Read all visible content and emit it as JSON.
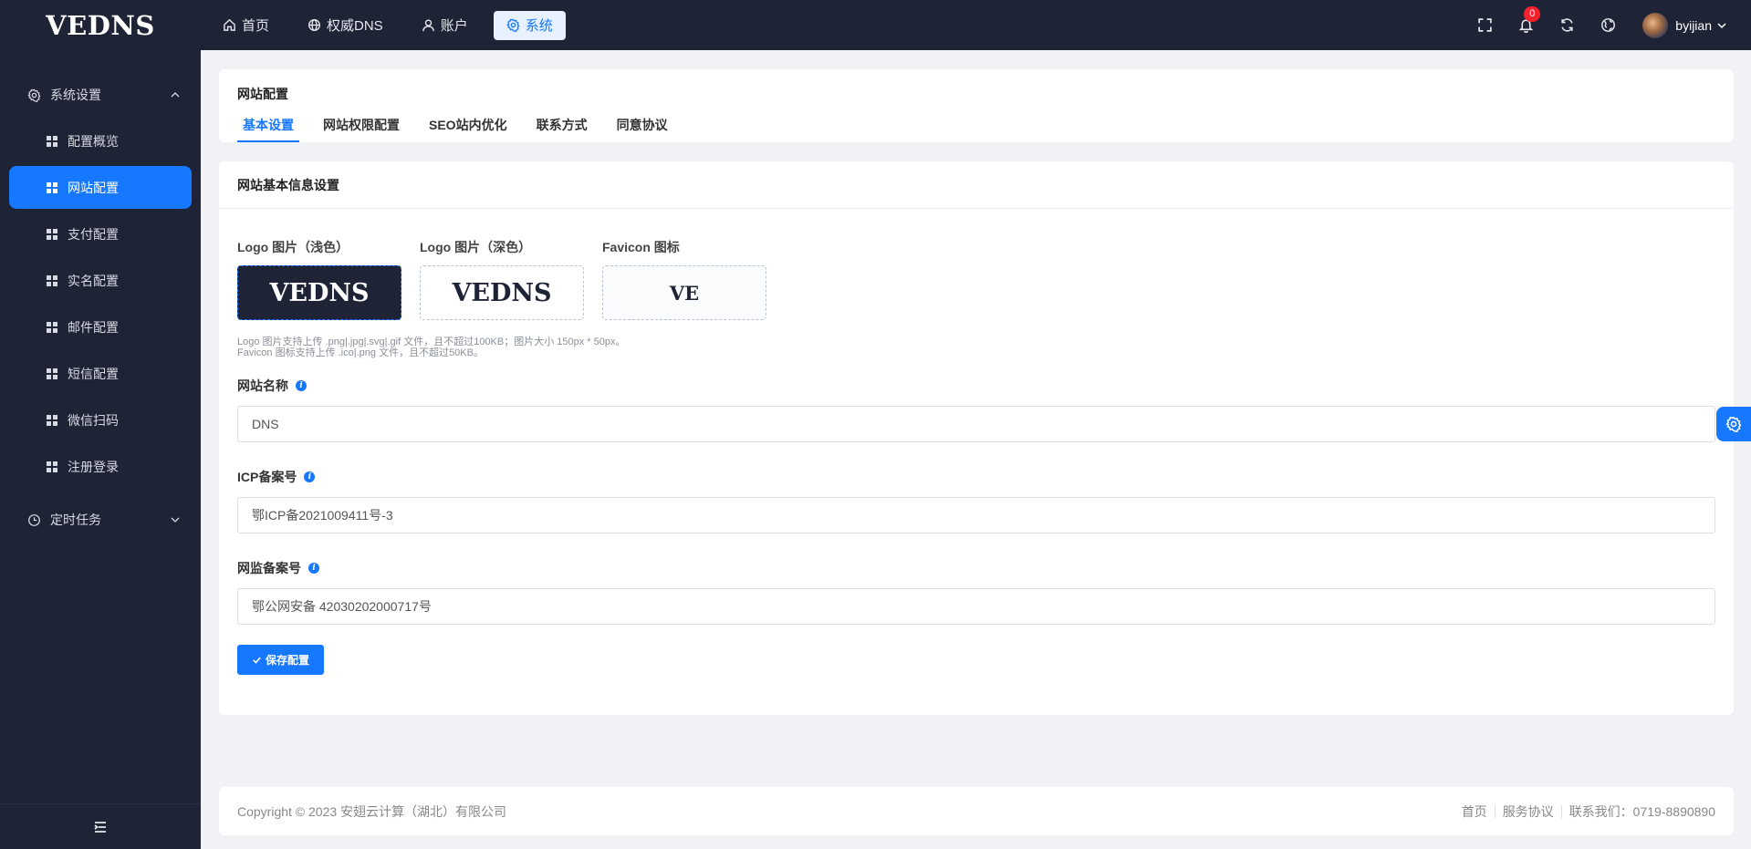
{
  "brand": "VEDNS",
  "topnav": [
    {
      "label": "首页",
      "icon": "home-icon"
    },
    {
      "label": "权威DNS",
      "icon": "globe-icon"
    },
    {
      "label": "账户",
      "icon": "user-icon"
    },
    {
      "label": "系统",
      "icon": "gear-icon",
      "active": true
    }
  ],
  "header": {
    "notification_count": "0",
    "username": "byijian"
  },
  "sidebar": {
    "group1": "系统设置",
    "items": [
      {
        "label": "配置概览"
      },
      {
        "label": "网站配置",
        "active": true
      },
      {
        "label": "支付配置"
      },
      {
        "label": "实名配置"
      },
      {
        "label": "邮件配置"
      },
      {
        "label": "短信配置"
      },
      {
        "label": "微信扫码"
      },
      {
        "label": "注册登录"
      }
    ],
    "group2": "定时任务"
  },
  "page": {
    "title": "网站配置",
    "tabs": [
      "基本设置",
      "网站权限配置",
      "SEO站内优化",
      "联系方式",
      "同意协议"
    ]
  },
  "form": {
    "section_title": "网站基本信息设置",
    "logo_light_label": "Logo 图片（浅色）",
    "logo_dark_label": "Logo 图片（深色）",
    "favicon_label": "Favicon 图标",
    "logo_light_text": "VEDNS",
    "logo_dark_text": "VEDNS",
    "favicon_text": "VE",
    "hint_line1": "Logo 图片支持上传 .png|.jpg|.svg|.gif 文件，且不超过100KB；图片大小 150px * 50px。",
    "hint_line2": "Favicon 图标支持上传 .ico|.png 文件，且不超过50KB。",
    "site_name_label": "网站名称",
    "site_name_value": "DNS",
    "icp_label": "ICP备案号",
    "icp_value": "鄂ICP备2021009411号-3",
    "police_label": "网监备案号",
    "police_value": "鄂公网安备 42030202000717号",
    "save_label": "保存配置"
  },
  "footer": {
    "copyright": "Copyright © 2023 安翅云计算（湖北）有限公司",
    "links": [
      "首页",
      "服务协议",
      "联系我们：0719-8890890"
    ]
  },
  "colors": {
    "primary": "#1677ff",
    "dark_bg": "#1f2336",
    "badge": "#f5222d"
  }
}
